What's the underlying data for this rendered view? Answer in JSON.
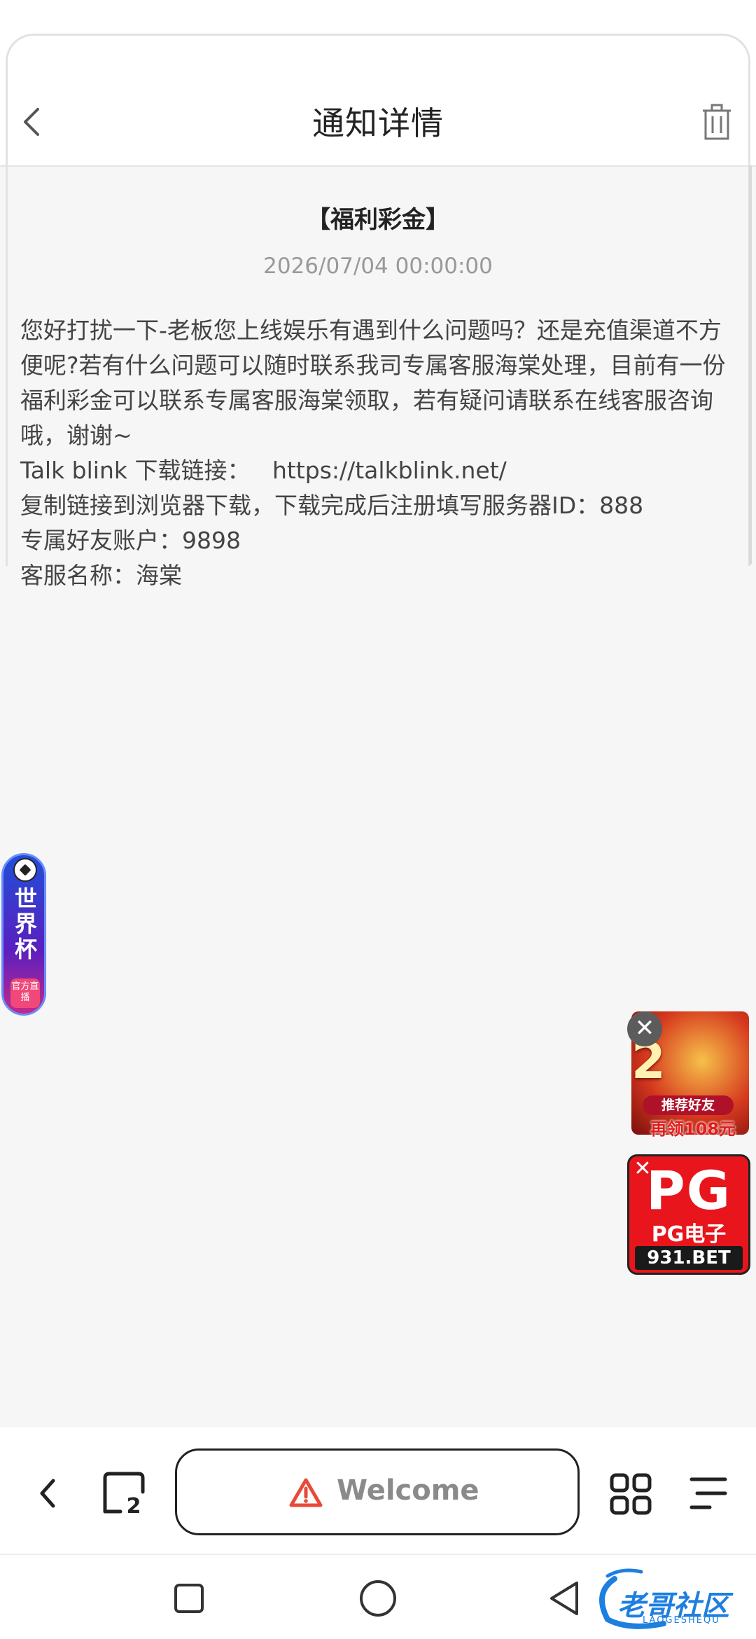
{
  "header": {
    "title": "通知详情"
  },
  "notice": {
    "title": "【福利彩金】",
    "time": "2026/07/04 00:00:00",
    "body": "您好打扰一下-老板您上线娱乐有遇到什么问题吗？还是充值渠道不方便呢?若有什么问题可以随时联系我司专属客服海棠处理，目前有一份福利彩金可以联系专属客服海棠领取，若有疑问请联系在线客服咨询哦，谢谢~\nTalk blink 下载链接：   https://talkblink.net/\n复制链接到浏览器下载，下载完成后注册填写服务器ID：888\n专属好友账户：9898\n客服名称：海棠"
  },
  "floating": {
    "worldcup_text": "世界杯",
    "worldcup_live": "官方直播",
    "ad1_number": "2",
    "ad1_tag": "推荐好友",
    "ad1_reward": "再领108元",
    "ad2_big": "PG",
    "ad2_sub": "PG电子",
    "ad2_site": "931.BET",
    "close_glyph": "✕"
  },
  "browser": {
    "tab_count": "2",
    "url_label": "Welcome"
  },
  "watermark": {
    "text": "老哥社区",
    "sub": "LAOGESHEQU"
  },
  "colors": {
    "warning": "#e84a3a",
    "accent_watermark": "#1d7fe0"
  }
}
